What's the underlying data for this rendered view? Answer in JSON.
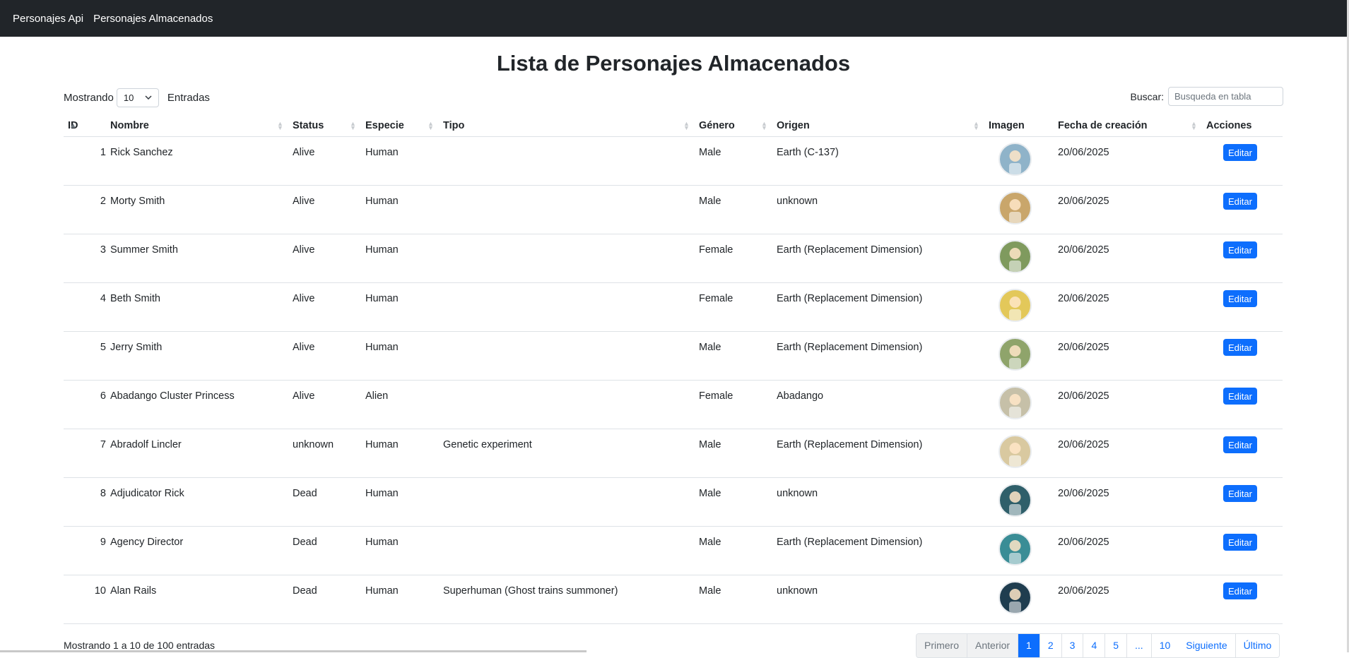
{
  "navbar": {
    "links": [
      "Personajes Api",
      "Personajes Almacenados"
    ]
  },
  "page_title": "Lista de Personajes Almacenados",
  "length": {
    "prefix": "Mostrando",
    "value": "10",
    "suffix": "Entradas"
  },
  "search": {
    "label": "Buscar:",
    "placeholder": "Busqueda en tabla"
  },
  "table": {
    "headers": [
      "ID",
      "Nombre",
      "Status",
      "Especie",
      "Tipo",
      "Género",
      "Origen",
      "Imagen",
      "Fecha de creación",
      "Acciones"
    ],
    "rows": [
      {
        "id": "1",
        "nombre": "Rick Sanchez",
        "status": "Alive",
        "especie": "Human",
        "tipo": "",
        "genero": "Male",
        "origen": "Earth (C-137)",
        "fecha": "20/06/2025",
        "accion": "Editar",
        "avatar_color": "#8fb3c9"
      },
      {
        "id": "2",
        "nombre": "Morty Smith",
        "status": "Alive",
        "especie": "Human",
        "tipo": "",
        "genero": "Male",
        "origen": "unknown",
        "fecha": "20/06/2025",
        "accion": "Editar",
        "avatar_color": "#c9a66b"
      },
      {
        "id": "3",
        "nombre": "Summer Smith",
        "status": "Alive",
        "especie": "Human",
        "tipo": "",
        "genero": "Female",
        "origen": "Earth (Replacement Dimension)",
        "fecha": "20/06/2025",
        "accion": "Editar",
        "avatar_color": "#7f9a5e"
      },
      {
        "id": "4",
        "nombre": "Beth Smith",
        "status": "Alive",
        "especie": "Human",
        "tipo": "",
        "genero": "Female",
        "origen": "Earth (Replacement Dimension)",
        "fecha": "20/06/2025",
        "accion": "Editar",
        "avatar_color": "#e3c85a"
      },
      {
        "id": "5",
        "nombre": "Jerry Smith",
        "status": "Alive",
        "especie": "Human",
        "tipo": "",
        "genero": "Male",
        "origen": "Earth (Replacement Dimension)",
        "fecha": "20/06/2025",
        "accion": "Editar",
        "avatar_color": "#8fa46b"
      },
      {
        "id": "6",
        "nombre": "Abadango Cluster Princess",
        "status": "Alive",
        "especie": "Alien",
        "tipo": "",
        "genero": "Female",
        "origen": "Abadango",
        "fecha": "20/06/2025",
        "accion": "Editar",
        "avatar_color": "#c6c0a8"
      },
      {
        "id": "7",
        "nombre": "Abradolf Lincler",
        "status": "unknown",
        "especie": "Human",
        "tipo": "Genetic experiment",
        "genero": "Male",
        "origen": "Earth (Replacement Dimension)",
        "fecha": "20/06/2025",
        "accion": "Editar",
        "avatar_color": "#d9c9a0"
      },
      {
        "id": "8",
        "nombre": "Adjudicator Rick",
        "status": "Dead",
        "especie": "Human",
        "tipo": "",
        "genero": "Male",
        "origen": "unknown",
        "fecha": "20/06/2025",
        "accion": "Editar",
        "avatar_color": "#2f5f6a"
      },
      {
        "id": "9",
        "nombre": "Agency Director",
        "status": "Dead",
        "especie": "Human",
        "tipo": "",
        "genero": "Male",
        "origen": "Earth (Replacement Dimension)",
        "fecha": "20/06/2025",
        "accion": "Editar",
        "avatar_color": "#3a8d96"
      },
      {
        "id": "10",
        "nombre": "Alan Rails",
        "status": "Dead",
        "especie": "Human",
        "tipo": "Superhuman (Ghost trains summoner)",
        "genero": "Male",
        "origen": "unknown",
        "fecha": "20/06/2025",
        "accion": "Editar",
        "avatar_color": "#1f3d4f"
      }
    ]
  },
  "info": "Mostrando 1 a 10 de 100 entradas",
  "pagination": {
    "first": "Primero",
    "prev": "Anterior",
    "pages": [
      "1",
      "2",
      "3",
      "4",
      "5",
      "...",
      "10"
    ],
    "active_page": "1",
    "next": "Siguiente",
    "last": "Último"
  },
  "colors": {
    "navbar": "#212529",
    "primary": "#0d6efd"
  }
}
